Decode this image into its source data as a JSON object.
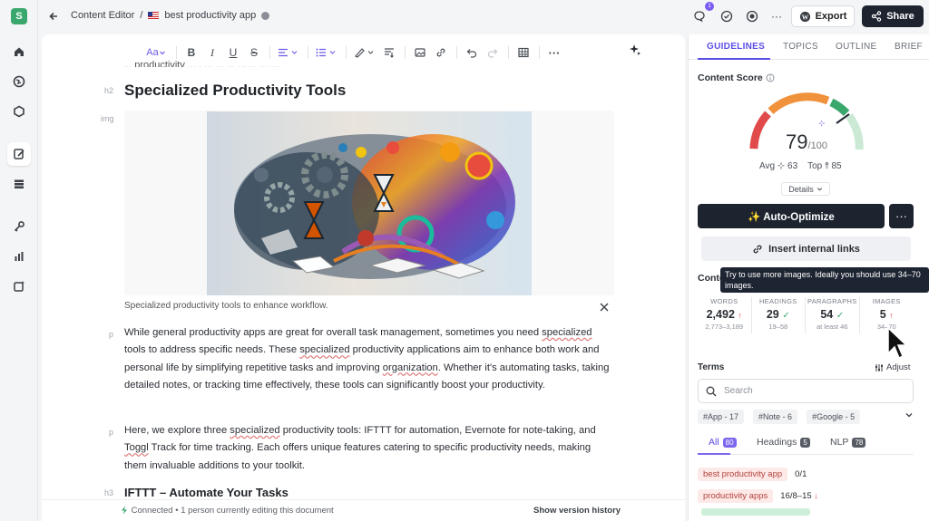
{
  "app": {
    "logo": "S"
  },
  "breadcrumb": {
    "section": "Content Editor",
    "separator": "/",
    "doc_title": "best productivity app"
  },
  "topbar": {
    "notification_count": "1",
    "export_label": "Export",
    "share_label": "Share"
  },
  "editor": {
    "format_style_label": "Aa",
    "cut_off_text": "... productivity ... , ... ... ... ... ... ... ...",
    "h2_tag": "h2",
    "h2_text": "Specialized Productivity Tools",
    "img_tag": "img",
    "image_caption": "Specialized productivity tools to enhance workflow.",
    "p_tag": "p",
    "paragraph1": [
      "While general productivity apps are great for overall task management, sometimes you need ",
      "specialized",
      " tools to address specific needs. These ",
      "specialized",
      " productivity applications aim to enhance both work and personal life by simplifying repetitive tasks and improving ",
      "organization",
      ". Whether it's automating tasks, taking detailed notes, or tracking time effectively, these tools can significantly boost your productivity."
    ],
    "paragraph2": [
      "Here, we explore three ",
      "specialized",
      " productivity tools: IFTTT for automation, Evernote for note-taking, and ",
      "Toggl",
      " Track for time tracking. Each offers unique features catering to specific productivity needs, making them invaluable additions to your toolkit."
    ],
    "h3_tag": "h3",
    "h3_text": "IFTTT – Automate Your Tasks",
    "status_connected": "Connected • 1 person currently editing this document",
    "version_history": "Show version history"
  },
  "panel": {
    "tabs": [
      "GUIDELINES",
      "TOPICS",
      "OUTLINE",
      "BRIEF"
    ],
    "active_tab": "GUIDELINES",
    "content_score_title": "Content Score",
    "score": "79",
    "score_max": "/100",
    "score_value": 79,
    "avg_label": "Avg",
    "avg_value": "63",
    "top_label": "Top",
    "top_value": "85",
    "details_label": "Details",
    "auto_optimize": "✨ Auto-Optimize",
    "more_label": "···",
    "internal_links": "Insert internal links",
    "content_title": "Content Structure",
    "stats": [
      {
        "label": "WORDS",
        "value": "2,492",
        "indicator": "↑",
        "range": "2,773–3,189"
      },
      {
        "label": "HEADINGS",
        "value": "29",
        "indicator": "✓",
        "range": "19–58"
      },
      {
        "label": "PARAGRAPHS",
        "value": "54",
        "indicator": "✓",
        "range": "at least 46"
      },
      {
        "label": "IMAGES",
        "value": "5",
        "indicator": "↑",
        "range": "34–70"
      }
    ],
    "tooltip": "Try to use more images. Ideally you should use 34–70 images.",
    "terms_title": "Terms",
    "adjust_label": "Adjust",
    "search_placeholder": "Search",
    "hashtags": [
      "#App - 17",
      "#Note - 6",
      "#Google - 5"
    ],
    "term_tabs": [
      {
        "label": "All",
        "count": "80"
      },
      {
        "label": "Headings",
        "count": "5"
      },
      {
        "label": "NLP",
        "count": "78"
      }
    ],
    "keywords": [
      {
        "term": "best productivity app",
        "count": "0/1",
        "indicator": ""
      },
      {
        "term": "productivity apps",
        "count": "16/8–15",
        "indicator": "↓"
      }
    ]
  },
  "colors": {
    "accent": "#5b4ee6",
    "dark": "#1d2430",
    "red": "#e04a4a",
    "green": "#3aa76d"
  }
}
